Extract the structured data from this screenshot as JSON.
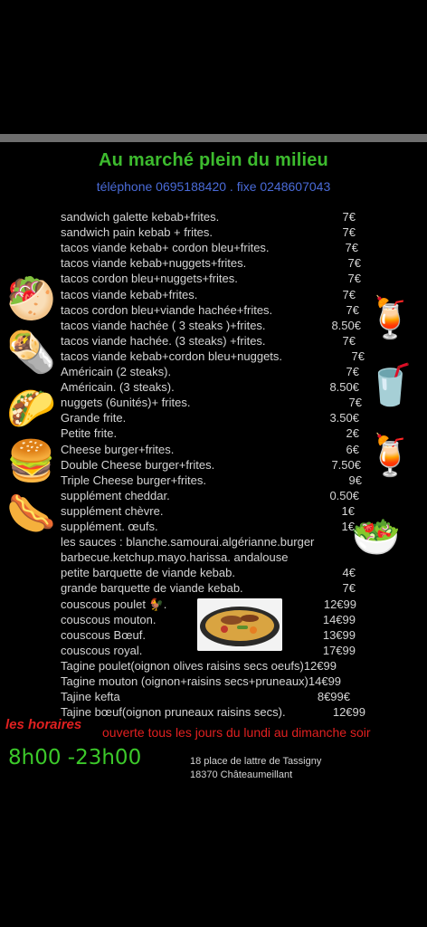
{
  "header": {
    "title": "Au marché plein du milieu",
    "phone": "téléphone 0695188420 . fixe 0248607043"
  },
  "menu": [
    {
      "label": "sandwich galette kebab+frites.",
      "price": "7€"
    },
    {
      "label": "sandwich pain kebab + frites.",
      "price": "7€"
    },
    {
      "label": "tacos viande kebab+ cordon bleu+frites.",
      "price": "7€"
    },
    {
      "label": "tacos viande kebab+nuggets+frites.",
      "price": "7€"
    },
    {
      "label": "tacos cordon bleu+nuggets+frites.",
      "price": "7€"
    },
    {
      "label": "tacos viande kebab+frites.",
      "price": "7€"
    },
    {
      "label": "tacos cordon bleu+viande hachée+frites.",
      "price": "7€"
    },
    {
      "label": "tacos viande hachée ( 3 steaks )+frites.",
      "price": "8.50€"
    },
    {
      "label": "tacos viande hachée. (3 steaks) +frites.",
      "price": "7€"
    },
    {
      "label": "tacos viande kebab+cordon bleu+nuggets.",
      "price": "7€"
    },
    {
      "label": "Américain (2 steaks).",
      "price": "7€"
    },
    {
      "label": "Américain. (3 steaks).",
      "price": "8.50€"
    },
    {
      "label": "nuggets (6unités)+ frites.",
      "price": "7€"
    },
    {
      "label": "Grande frite.",
      "price": "3.50€"
    },
    {
      "label": "Petite frite.",
      "price": "2€"
    },
    {
      "label": "Cheese burger+frites.",
      "price": "6€"
    },
    {
      "label": "Double Cheese burger+frites.",
      "price": "7.50€"
    },
    {
      "label": "Triple Cheese burger+frites.",
      "price": "9€"
    },
    {
      "label": "supplément cheddar.",
      "price": "0.50€"
    },
    {
      "label": "supplément  chèvre.",
      "price": "1€"
    },
    {
      "label": "supplément. œufs.",
      "price": "1€"
    },
    {
      "label": "les sauces : blanche.samourai.algérianne.burger",
      "price": ""
    },
    {
      "label": "barbecue.ketchup.mayo.harissa. andalouse",
      "price": ""
    },
    {
      "label": "petite barquette de viande kebab.",
      "price": "4€"
    },
    {
      "label": "grande barquette de viande kebab.",
      "price": "7€"
    },
    {
      "label": "couscous poulet 🐓.",
      "price": "12€99"
    },
    {
      "label": "couscous mouton.",
      "price": "14€99"
    },
    {
      "label": "couscous Bœuf.",
      "price": "13€99"
    },
    {
      "label": "couscous royal.",
      "price": "17€99"
    },
    {
      "label": "Tagine poulet(oignon olives raisins secs oeufs)12€99",
      "price": ""
    },
    {
      "label": "Tagine mouton (oignon+raisins secs+pruneaux)14€99",
      "price": ""
    },
    {
      "label": "Tajine kefta",
      "price": "8€99€"
    },
    {
      "label": "Tajine bœuf(oignon pruneaux raisins secs).",
      "price": "12€99"
    }
  ],
  "footer": {
    "hours_label": "les horaires",
    "opening": "ouverte tous les jours du lundi au dimanche soir",
    "hours": "8h00 -23h00",
    "address_line1": "18 place de lattre de Tassigny",
    "address_line2": "18370 Châteaumeillant"
  },
  "icons": [
    "burrito-icon",
    "wrap-icon",
    "taco-icon",
    "burger-icon",
    "hotdog-icon",
    "cocktail-icon",
    "soda-cup-icon",
    "cocktail-icon",
    "salad-icon"
  ],
  "colors": {
    "title": "#3dbb2e",
    "phone": "#4a6bd8",
    "text": "#d4d4d4",
    "hours": "#3cc82a",
    "open_text": "#e02020"
  }
}
